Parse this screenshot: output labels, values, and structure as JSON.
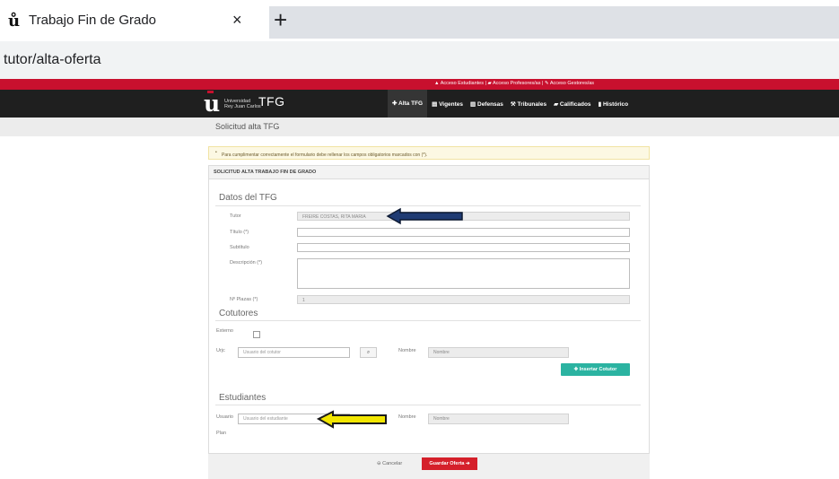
{
  "browser": {
    "tab_title": "Trabajo Fin de Grado",
    "tab_close": "×",
    "new_tab": "+",
    "url": "tutor/alta-oferta"
  },
  "topbar": {
    "acceso_estudiantes": "Acceso Estudiantes",
    "acceso_profesores": "Acceso Profesores/as",
    "acceso_gestores": "Acceso Gestores/as",
    "separator": "|"
  },
  "brand": {
    "university_line1": "Universidad",
    "university_line2": "Rey Juan Carlos",
    "app_name": "TFG",
    "accent_color": "#c8102e"
  },
  "nav": {
    "alta_tfg": "Alta TFG",
    "vigentes": "Vigentes",
    "defensas": "Defensas",
    "tribunales": "Tribunales",
    "calificados": "Calificados",
    "historico": "Histórico"
  },
  "page": {
    "title": "Solicitud alta TFG",
    "alert": "Para cumplimentar correctamente el formulario debe rellenar los campos obligatorios marcados con (*).",
    "panel_title": "SOLICITUD ALTA TRABAJO FIN DE GRADO"
  },
  "datos": {
    "section_title": "Datos del TFG",
    "tutor_label": "Tutor",
    "tutor_value": "FREIRE COSTAS, RITA MARIA",
    "titulo_label": "Título (*)",
    "subtitulo_label": "Subtítulo",
    "descripcion_label": "Descripción (*)",
    "plazas_label": "Nº Plazas (*)",
    "plazas_value": "1"
  },
  "cotutores": {
    "section_title": "Cotutores",
    "externo_label": "Externo",
    "urjc_label": "Urjc",
    "usuario_placeholder": "Usuario del cotutor",
    "nombre_label": "Nombre",
    "nombre_placeholder": "Nombre",
    "insertar_label": "Insertar Cotutor"
  },
  "estudiantes": {
    "section_title": "Estudiantes",
    "usuario_label": "Usuario",
    "usuario_placeholder": "Usuario del estudiante",
    "nombre_label": "Nombre",
    "nombre_placeholder": "Nombre",
    "plan_label": "Plan"
  },
  "actions": {
    "cancelar": "Cancelar",
    "guardar": "Guardar Oferta"
  },
  "annotations": {
    "arrow_tutor_color": "#1f3b73",
    "arrow_estudiante_color": "#f2e600"
  }
}
